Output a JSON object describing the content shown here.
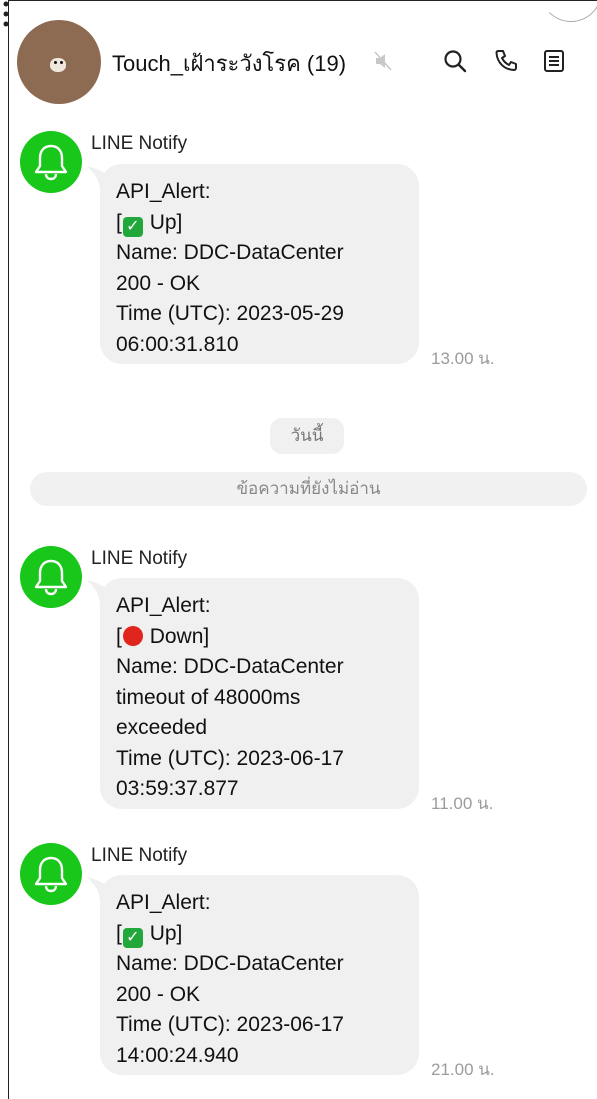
{
  "header": {
    "title": "Touch_เฝ้าระวังโรค (19)",
    "icons": [
      "mute-icon",
      "search-icon",
      "call-icon",
      "notes-icon",
      "more-icon"
    ]
  },
  "colors": {
    "notify_green": "#18c719",
    "bubble": "#f0f0f0",
    "time": "#9b9b9b"
  },
  "date_separator": "วันนี้",
  "unread_separator": "ข้อความที่ยังไม่อ่าน",
  "messages": [
    {
      "sender": "LINE Notify",
      "status_emoji": "check-mark-icon",
      "lines": [
        "API_Alert:",
        "[",
        "Up]",
        "Name: DDC-DataCenter",
        "200 - OK",
        "Time (UTC): 2023-05-29",
        "06:00:31.810"
      ],
      "time": "13.00 น."
    },
    {
      "sender": "LINE Notify",
      "status_emoji": "red-circle-icon",
      "lines": [
        "API_Alert:",
        "[",
        "Down]",
        "Name: DDC-DataCenter",
        "timeout of 48000ms",
        "exceeded",
        "Time (UTC): 2023-06-17",
        "03:59:37.877"
      ],
      "time": "11.00 น."
    },
    {
      "sender": "LINE Notify",
      "status_emoji": "check-mark-icon",
      "lines": [
        "API_Alert:",
        "[",
        "Up]",
        "Name: DDC-DataCenter",
        "200 - OK",
        "Time (UTC): 2023-06-17",
        "14:00:24.940"
      ],
      "time": "21.00 น."
    }
  ]
}
